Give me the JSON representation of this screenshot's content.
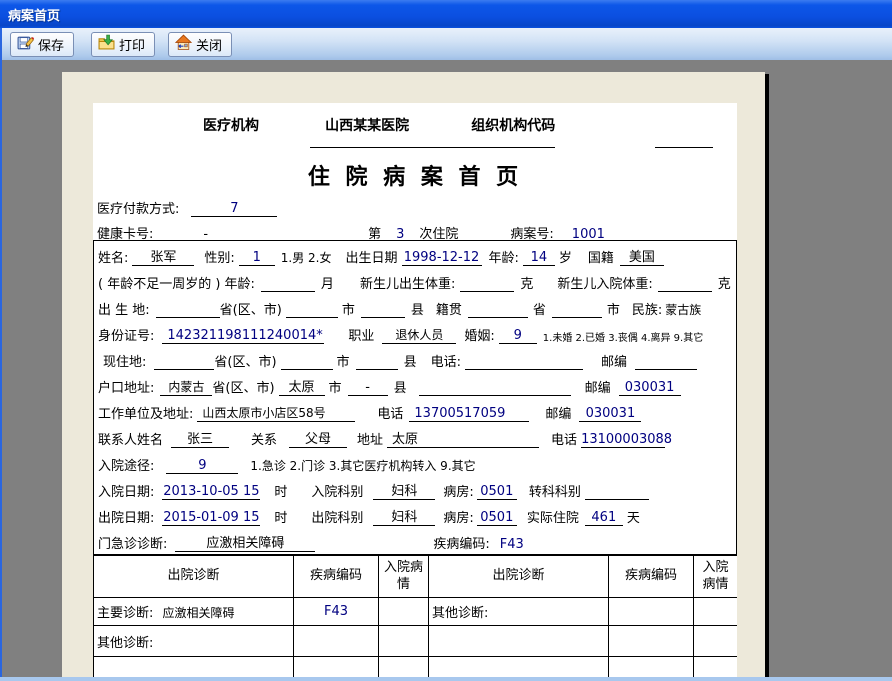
{
  "window": {
    "title": "病案首页"
  },
  "toolbar": {
    "save": "保存",
    "print": "打印",
    "close": "关闭"
  },
  "header": {
    "org_label": "医疗机构",
    "org_value": "山西某某医院",
    "org_code_label": "组织机构代码",
    "title": "住 院 病 案 首 页"
  },
  "meta": {
    "payment_label": "医疗付款方式:",
    "payment_value": "7",
    "health_card_label": "健康卡号:",
    "health_card_value": "-",
    "admission_no_prefix": "第",
    "admission_no": "3",
    "admission_no_suffix": "次住院",
    "record_no_label": "病案号:",
    "record_no": "1001"
  },
  "patient": {
    "name_label": "姓名:",
    "name": "张军",
    "gender_label": "性别:",
    "gender": "1",
    "gender_options": "1.男 2.女",
    "dob_label": "出生日期",
    "dob": "1998-12-12",
    "age_label": "年龄:",
    "age": "14",
    "age_unit": "岁",
    "nationality_label": "国籍",
    "nationality": "美国",
    "infant_age_label": "( 年龄不足一周岁的 ) 年龄:",
    "infant_age_unit": "月",
    "birth_weight_label": "新生儿出生体重:",
    "birth_weight_unit": "克",
    "admit_weight_label": "新生儿入院体重:",
    "admit_weight_unit": "克",
    "birthplace_label": "出 生 地:",
    "province_label": "省(区、市)",
    "city_label": "市",
    "county_label": "县",
    "native_label": "籍贯",
    "native_province_label": "省",
    "native_city_label": "市",
    "ethnic_label": "民族:",
    "ethnic": "蒙古族",
    "id_label": "身份证号:",
    "id_number": "142321198111240014*",
    "occupation_label": "职业",
    "occupation": "退休人员",
    "marriage_label": "婚姻:",
    "marriage": "9",
    "marriage_options": "1.未婚 2.已婚 3.丧偶 4.离异 9.其它",
    "residence_label": "现住地:",
    "phone_label": "电话:",
    "zip_label": "邮编",
    "registered_label": "户口地址:",
    "registered_province": "内蒙古",
    "registered_city": "太原",
    "registered_county": "-",
    "registered_zip": "030031",
    "work_label": "工作单位及地址:",
    "work_address": "山西太原市小店区58号",
    "work_phone_label": "电话",
    "work_phone": "13700517059",
    "work_zip": "030031",
    "contact_label": "联系人姓名",
    "contact_name": "张三",
    "relation_label": "关系",
    "relation": "父母",
    "contact_addr_label": "地址",
    "contact_addr": "太原",
    "contact_phone_label": "电话",
    "contact_phone": "13100003088"
  },
  "admission": {
    "route_label": "入院途径:",
    "route": "9",
    "route_options": "1.急诊 2.门诊 3.其它医疗机构转入 9.其它",
    "admit_date_label": "入院日期:",
    "admit_date": "2013-10-05 15",
    "hour_unit": "时",
    "admit_dept_label": "入院科别",
    "admit_dept": "妇科",
    "ward_label": "病房:",
    "admit_ward": "0501",
    "transfer_label": "转科科别",
    "discharge_date_label": "出院日期:",
    "discharge_date": "2015-01-09 15",
    "discharge_dept_label": "出院科别",
    "discharge_dept": "妇科",
    "discharge_ward": "0501",
    "stay_label": "实际住院",
    "stay_days": "461",
    "stay_unit": "天",
    "er_diag_label": "门急诊诊断:",
    "er_diag": "应激相关障碍",
    "disease_code_label": "疾病编码:",
    "disease_code": "F43"
  },
  "diagnosis_table": {
    "headers": [
      "出院诊断",
      "疾病编码",
      "入院病情",
      "出院诊断",
      "疾病编码",
      "入院病情"
    ],
    "main_diag_label": "主要诊断:",
    "main_diag": "应激相关障碍",
    "main_diag_code": "F43",
    "other_diag_label_right": "其他诊断:",
    "other_diag_label_row2": "其他诊断:"
  },
  "colors": {
    "value_navy": "#000080",
    "titlebar_blue": "#0B4FE0",
    "page_cream": "#EDE9DA",
    "desktop_gray": "#808080"
  }
}
